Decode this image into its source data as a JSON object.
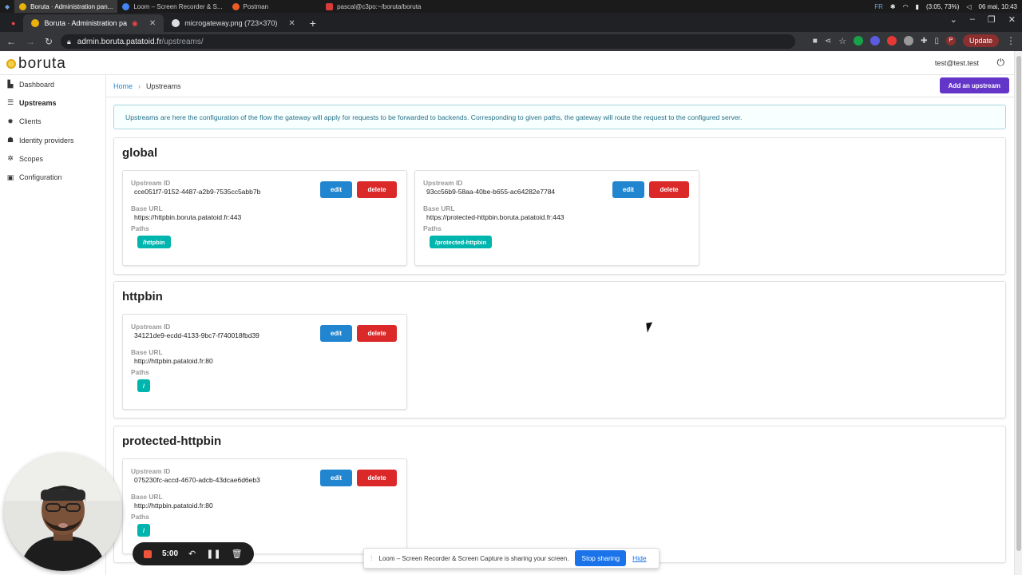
{
  "os": {
    "apps": [
      {
        "label": "Boruta · Administration pan...",
        "color": "#e8b10c"
      },
      {
        "label": "Loom – Screen Recorder & S...",
        "color": "#4285f4"
      },
      {
        "label": "Postman",
        "color": "#ef5b25"
      },
      {
        "label": "pascal@c3po:~/boruta/boruta",
        "color": "#d93a3a"
      }
    ],
    "lang": "FR",
    "battery": "(3:05, 73%)",
    "datetime": "06 mai, 10:43"
  },
  "browser": {
    "tabs": [
      {
        "label": "Boruta · Administration pa",
        "active": true
      },
      {
        "label": "microgateway.png (723×370)",
        "active": false
      }
    ],
    "url_host": "admin.boruta.patatoid.fr",
    "url_path": "/upstreams/",
    "update_label": "Update",
    "profile_initial": "P"
  },
  "app": {
    "logo": "boruta",
    "user_email": "test@test.test",
    "nav": [
      {
        "label": "Dashboard",
        "icon": "chart-icon",
        "glyph": "▙"
      },
      {
        "label": "Upstreams",
        "icon": "server-icon",
        "glyph": "☰",
        "active": true
      },
      {
        "label": "Clients",
        "icon": "cog-icon",
        "glyph": "✹"
      },
      {
        "label": "Identity providers",
        "icon": "users-icon",
        "glyph": "☗"
      },
      {
        "label": "Scopes",
        "icon": "cogs-icon",
        "glyph": "✲"
      },
      {
        "label": "Configuration",
        "icon": "window-icon",
        "glyph": "▣"
      }
    ],
    "breadcrumb": {
      "home": "Home",
      "current": "Upstreams"
    },
    "add_button": "Add an upstream",
    "info": "Upstreams are here the configuration of the flow the gateway will apply for requests to be forwarded to backends. Corresponding to given paths, the gateway will route the request to the configured server.",
    "labels": {
      "upstream_id": "Upstream ID",
      "base_url": "Base URL",
      "paths": "Paths",
      "edit": "edit",
      "delete": "delete"
    },
    "groups": [
      {
        "name": "global",
        "upstreams": [
          {
            "id": "cce051f7-9152-4487-a2b9-7535cc5abb7b",
            "base_url": "https://httpbin.boruta.patatoid.fr:443",
            "path": "/httpbin"
          },
          {
            "id": "93cc56b9-58aa-40be-b655-ac64282e7784",
            "base_url": "https://protected-httpbin.boruta.patatoid.fr:443",
            "path": "/protected-httpbin"
          }
        ]
      },
      {
        "name": "httpbin",
        "upstreams": [
          {
            "id": "34121de9-ecdd-4133-9bc7-f740018fbd39",
            "base_url": "http://httpbin.patatoid.fr:80",
            "path": "/"
          }
        ]
      },
      {
        "name": "protected-httpbin",
        "upstreams": [
          {
            "id": "075230fc-accd-4670-adcb-43dcae6d6eb3",
            "base_url": "http://httpbin.patatoid.fr:80",
            "path": "/"
          }
        ]
      }
    ]
  },
  "loom": {
    "timer": "5:00",
    "share_message": "Loom – Screen Recorder & Screen Capture is sharing your screen.",
    "stop_label": "Stop sharing",
    "hide_label": "Hide"
  },
  "colors": {
    "primary": "#2185d0",
    "danger": "#db2828",
    "teal": "#00b5ad",
    "violet": "#6435c9"
  }
}
